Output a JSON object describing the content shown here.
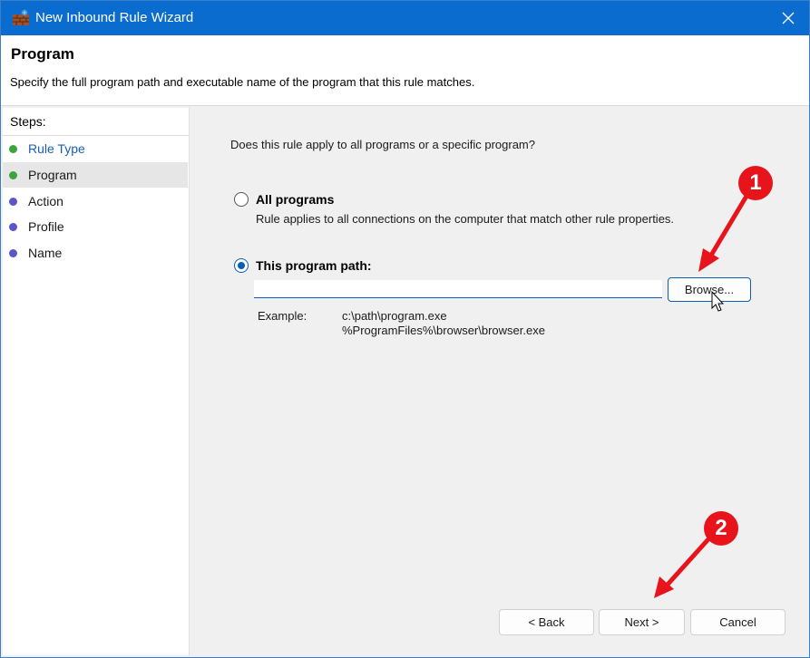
{
  "window": {
    "title": "New Inbound Rule Wizard",
    "accent": "#0a6ccf",
    "icons": {
      "app": "firewall-icon",
      "close": "close-icon"
    }
  },
  "header": {
    "title": "Program",
    "description": "Specify the full program path and executable name of the program that this rule matches."
  },
  "steps": {
    "heading": "Steps:",
    "items": [
      {
        "label": "Rule Type",
        "color": "#1a5fb4",
        "dot": "#3ba53b",
        "state": "completed"
      },
      {
        "label": "Program",
        "color": "#1a1a1a",
        "dot": "#3ba53b",
        "state": "current"
      },
      {
        "label": "Action",
        "color": "#1a1a1a",
        "dot": "#5a55c8",
        "state": "pending"
      },
      {
        "label": "Profile",
        "color": "#1a1a1a",
        "dot": "#5a55c8",
        "state": "pending"
      },
      {
        "label": "Name",
        "color": "#1a1a1a",
        "dot": "#5a55c8",
        "state": "pending"
      }
    ]
  },
  "main": {
    "question": "Does this rule apply to all programs or a specific program?",
    "option_all": {
      "label": "All programs",
      "description": "Rule applies to all connections on the computer that match other rule properties.",
      "checked": false
    },
    "option_path": {
      "label": "This program path:",
      "checked": true,
      "value": "",
      "browse_label": "Browse..."
    },
    "example": {
      "label": "Example:",
      "line1": "c:\\path\\program.exe",
      "line2": "%ProgramFiles%\\browser\\browser.exe"
    }
  },
  "footer": {
    "back_label": "< Back",
    "next_label": "Next >",
    "cancel_label": "Cancel"
  },
  "annotations": {
    "color": "#e8141c",
    "badge_1": "1",
    "badge_2": "2"
  }
}
